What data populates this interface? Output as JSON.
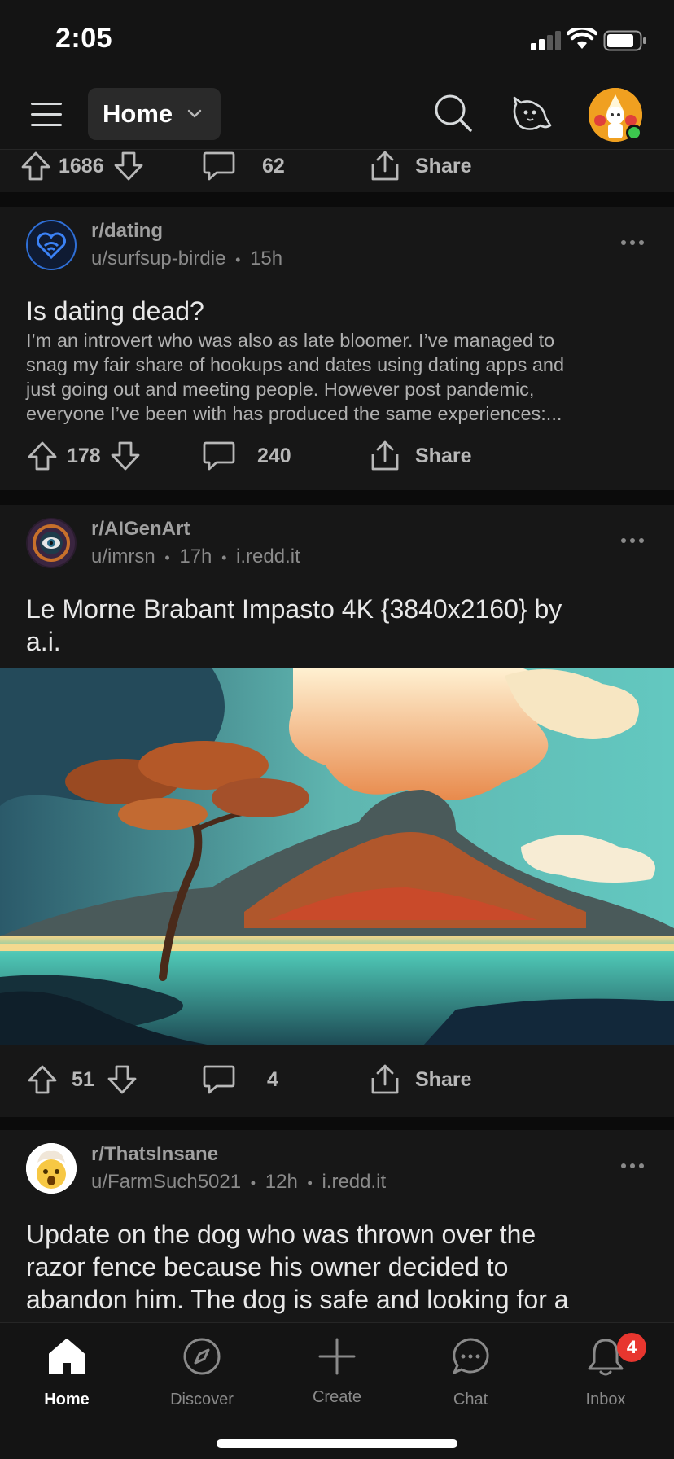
{
  "status_bar": {
    "time": "2:05"
  },
  "header": {
    "feed_label": "Home"
  },
  "top_card": {
    "upvotes": "1686",
    "comments": "62",
    "share_label": "Share"
  },
  "posts": [
    {
      "subreddit": "r/dating",
      "user": "u/surfsup-birdie",
      "age": "15h",
      "title": "Is dating dead?",
      "body_lines": [
        "I’m an introvert who was also as late bloomer. I’ve managed to",
        "snag my fair share of hookups and dates using dating apps and",
        "just going out and meeting people. However post pandemic,",
        "everyone I’ve been with has produced the same experiences:..."
      ],
      "upvotes": "178",
      "comments": "240",
      "share_label": "Share"
    },
    {
      "subreddit": "r/AIGenArt",
      "user": "u/imrsn",
      "age": "17h",
      "domain": "i.redd.it",
      "title_lines": [
        "Le Morne Brabant Impasto 4K {3840x2160} by",
        "a.i."
      ],
      "upvotes": "51",
      "comments": "4",
      "share_label": "Share"
    },
    {
      "subreddit": "r/ThatsInsane",
      "user": "u/FarmSuch5021",
      "age": "12h",
      "domain": "i.redd.it",
      "title_lines": [
        "Update on the dog who was thrown over the",
        "razor fence because his owner decided to",
        "abandon him. The dog is safe and looking for a"
      ]
    }
  ],
  "meta_separator": "•",
  "bottom_nav": {
    "tabs": [
      {
        "label": "Home",
        "icon": "home-icon"
      },
      {
        "label": "Discover",
        "icon": "compass-icon"
      },
      {
        "label": "Create",
        "icon": "plus-icon"
      },
      {
        "label": "Chat",
        "icon": "chat-icon"
      },
      {
        "label": "Inbox",
        "icon": "bell-icon"
      }
    ],
    "inbox_badge": "4"
  },
  "colors": {
    "background": "#0b0b0b",
    "card": "#171717",
    "badge": "#e8362f",
    "online": "#3cc74e"
  }
}
